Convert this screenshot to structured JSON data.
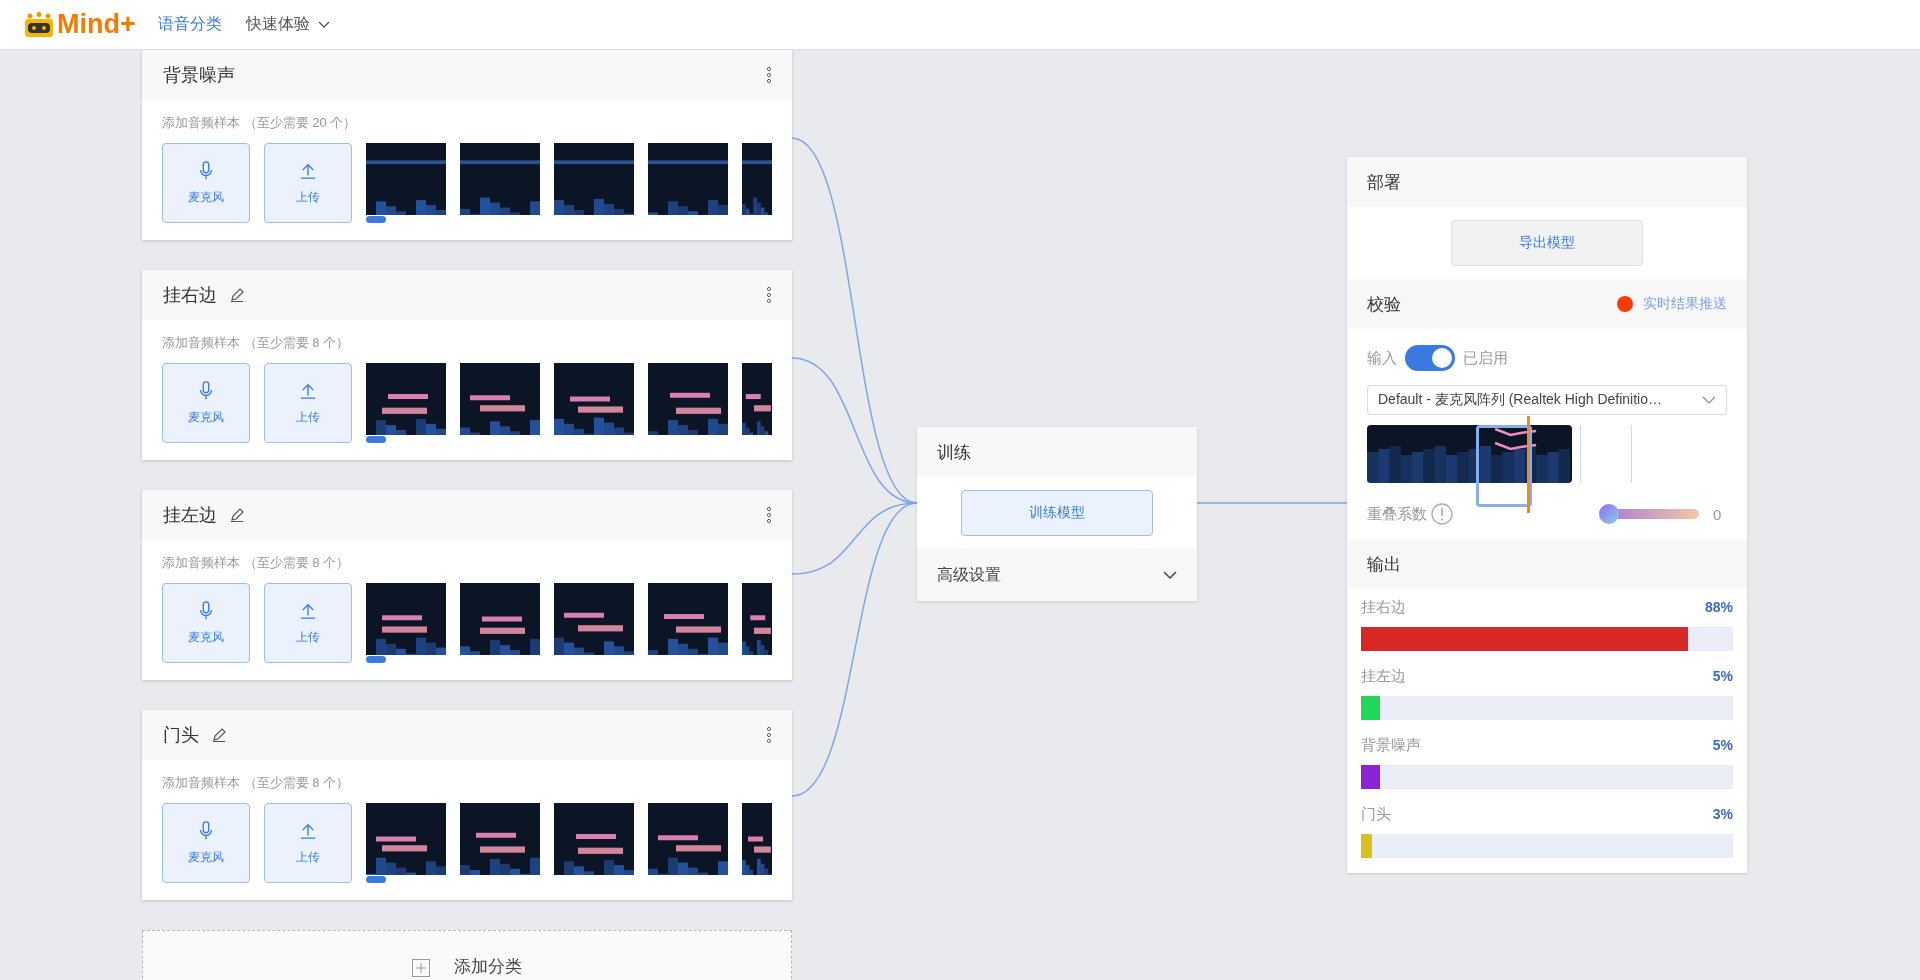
{
  "header": {
    "logo_text": "Mind+",
    "nav": [
      {
        "label": "语音分类",
        "selected": true,
        "dropdown": false
      },
      {
        "label": "快速体验",
        "selected": false,
        "dropdown": true
      }
    ]
  },
  "classes": [
    {
      "name": "背景噪声",
      "editable": false,
      "hint": "添加音频样本 （至少需要 20 个）",
      "mic_label": "麦克风",
      "upload_label": "上传"
    },
    {
      "name": "挂右边",
      "editable": true,
      "hint": "添加音频样本 （至少需要 8 个）",
      "mic_label": "麦克风",
      "upload_label": "上传"
    },
    {
      "name": "挂左边",
      "editable": true,
      "hint": "添加音频样本 （至少需要 8 个）",
      "mic_label": "麦克风",
      "upload_label": "上传"
    },
    {
      "name": "门头",
      "editable": true,
      "hint": "添加音频样本 （至少需要 8 个）",
      "mic_label": "麦克风",
      "upload_label": "上传"
    }
  ],
  "add_class": {
    "label": "添加分类"
  },
  "training": {
    "title": "训练",
    "button": "训练模型",
    "advanced": {
      "label": "高级设置",
      "expanded": false
    }
  },
  "deploy": {
    "title": "部署",
    "button": "导出模型"
  },
  "preview": {
    "title": "校验",
    "push_label": "实时结果推送",
    "input_label": "输入",
    "input_on": true,
    "input_state": "已启用",
    "device": "Default - 麦克风阵列 (Realtek High Definitio…",
    "overlap_label": "重叠系数",
    "overlap": {
      "level": 0,
      "reading": "0"
    }
  },
  "output": {
    "title": "输出",
    "results": [
      {
        "label": "挂右边",
        "percent": "88%",
        "level": 0.88,
        "color": "#d92828"
      },
      {
        "label": "挂左边",
        "percent": "5%",
        "level": 0.05,
        "color": "#22d65a"
      },
      {
        "label": "背景噪声",
        "percent": "5%",
        "level": 0.05,
        "color": "#8a24d6"
      },
      {
        "label": "门头",
        "percent": "3%",
        "level": 0.03,
        "color": "#d9c022"
      }
    ]
  }
}
